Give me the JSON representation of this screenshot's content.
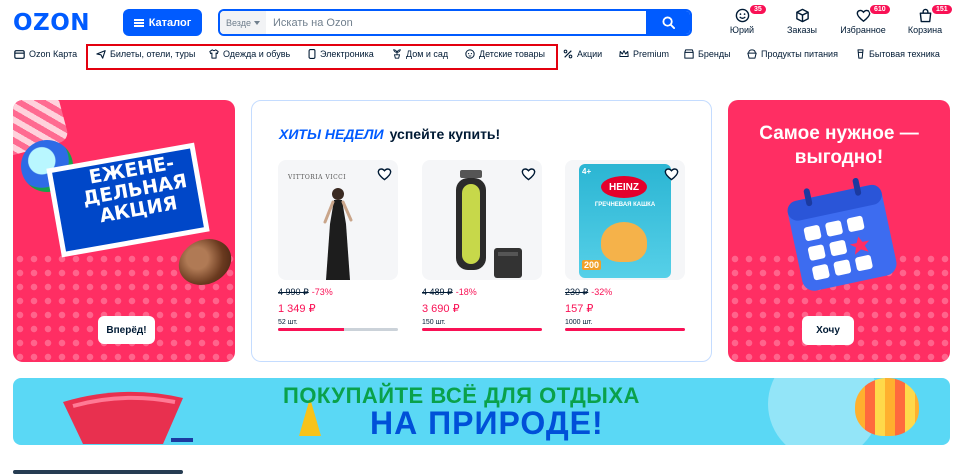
{
  "header": {
    "logo": "OZON",
    "catalog_label": "Каталог",
    "search": {
      "scope": "Везде",
      "placeholder": "Искать на Ozon"
    },
    "user": {
      "label": "Юрий",
      "badge": "35"
    },
    "orders": {
      "label": "Заказы"
    },
    "favorites": {
      "label": "Избранное",
      "badge": "610"
    },
    "cart": {
      "label": "Корзина",
      "badge": "151"
    }
  },
  "nav": {
    "items": [
      {
        "label": "Ozon Карта",
        "icon": "card-icon"
      },
      {
        "label": "Билеты, отели, туры",
        "icon": "plane-icon"
      },
      {
        "label": "Одежда и обувь",
        "icon": "shirt-icon"
      },
      {
        "label": "Электроника",
        "icon": "phone-icon"
      },
      {
        "label": "Дом и сад",
        "icon": "plant-icon"
      },
      {
        "label": "Детские товары",
        "icon": "baby-icon"
      },
      {
        "label": "Акции",
        "icon": "percent-icon"
      },
      {
        "label": "Premium",
        "icon": "crown-icon"
      },
      {
        "label": "Бренды",
        "icon": "store-icon"
      },
      {
        "label": "Продукты питания",
        "icon": "food-icon"
      },
      {
        "label": "Бытовая техника",
        "icon": "appliance-icon"
      }
    ]
  },
  "promo_left": {
    "title": "ЕЖЕНЕ-\nДЕЛЬНАЯ\nАКЦИЯ",
    "button": "Вперёд!"
  },
  "hits": {
    "title_accent": "ХИТЫ НЕДЕЛИ",
    "title_rest": "успейте купить!",
    "products": [
      {
        "image_text": "VITTORIA VICCI",
        "old_price": "4 990 ₽",
        "discount": "-73%",
        "price": "1 349 ₽",
        "stock": "52 шт.",
        "sold_fraction": 0.55
      },
      {
        "image_text": "",
        "old_price": "4 489 ₽",
        "discount": "-18%",
        "price": "3 690 ₽",
        "stock": "150 шт.",
        "sold_fraction": 1.0
      },
      {
        "image_text": "HEINZ",
        "image_subtext": "ГРЕЧНЕВАЯ КАШКА",
        "image_age": "4+",
        "image_weight": "200",
        "old_price": "230 ₽",
        "discount": "-32%",
        "price": "157 ₽",
        "stock": "1000 шт.",
        "sold_fraction": 1.0
      }
    ]
  },
  "promo_right": {
    "title": "Самое нужное —\nвыгодно!",
    "button": "Хочу"
  },
  "banner": {
    "line1": "ПОКУПАЙТЕ ВСЁ ДЛЯ ОТДЫХА",
    "line2": "НА ПРИРОДЕ!"
  },
  "colors": {
    "brand": "#005bff",
    "accent": "#f91155",
    "promo_bg": "#ff2e63",
    "highlight": "#e3000f"
  }
}
